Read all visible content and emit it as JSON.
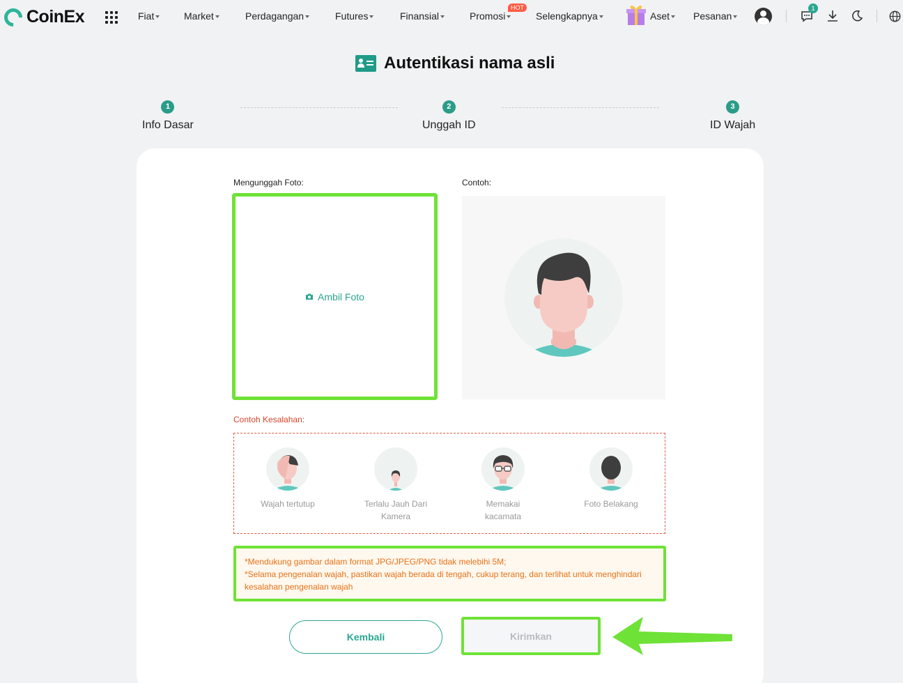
{
  "header": {
    "logo_text": "CoinEx",
    "nav": [
      "Fiat",
      "Market",
      "Perdagangan",
      "Futures",
      "Finansial",
      "Promosi",
      "Selengkapnya",
      "Aset",
      "Pesanan"
    ],
    "hot_badge": "HOT",
    "notification_count": "1",
    "icons": [
      "apps-grid-icon",
      "gift-icon",
      "avatar-icon",
      "message-icon",
      "download-icon",
      "moon-icon",
      "globe-icon"
    ]
  },
  "page": {
    "title": "Autentikasi nama asli"
  },
  "steps": [
    {
      "num": "1",
      "label": "Info Dasar"
    },
    {
      "num": "2",
      "label": "Unggah ID"
    },
    {
      "num": "3",
      "label": "ID Wajah"
    }
  ],
  "form": {
    "upload_label": "Mengunggah Foto:",
    "take_photo": "Ambil Foto",
    "sample_label": "Contoh:",
    "wrong_label": "Contoh Kesalahan:",
    "wrong_examples": [
      {
        "line1": "Wajah tertutup",
        "line2": ""
      },
      {
        "line1": "Terlalu Jauh Dari",
        "line2": "Kamera"
      },
      {
        "line1": "Memakai",
        "line2": "kacamata"
      },
      {
        "line1": "Foto Belakang",
        "line2": ""
      }
    ],
    "notes": [
      "*Mendukung gambar dalam format JPG/JPEG/PNG tidak melebihi 5M;",
      "*Selama pengenalan wajah, pastikan wajah berada di tengah, cukup terang, dan terlihat untuk menghindari kesalahan pengenalan wajah"
    ],
    "back_label": "Kembali",
    "submit_label": "Kirimkan"
  },
  "colors": {
    "accent": "#2aa690",
    "highlight": "#6ee236",
    "error": "#d6452c",
    "note_text": "#e67218"
  }
}
